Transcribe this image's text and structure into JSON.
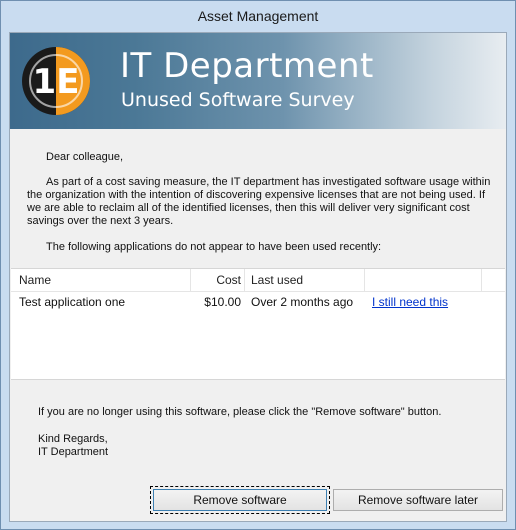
{
  "window": {
    "title": "Asset Management"
  },
  "banner": {
    "logo_text": "1E",
    "title": "IT Department",
    "subtitle": "Unused Software Survey"
  },
  "letter": {
    "greeting": "Dear colleague,",
    "paragraph1": "As part of a cost saving measure, the IT department has investigated software usage within the organization with the intention of discovering expensive licenses that are not being used. If we are able to reclaim all of the identified licenses, then this will deliver very significant cost savings over the next 3 years.",
    "paragraph2": "The following applications do not appear to have been used recently:"
  },
  "list": {
    "columns": [
      "Name",
      "Cost",
      "Last used",
      ""
    ],
    "rows": [
      {
        "name": "Test application one",
        "cost": "$10.00",
        "last_used": "Over 2 months ago",
        "action": "I still need this"
      }
    ]
  },
  "footer": {
    "instruction": "If you are no longer using this software, please click the \"Remove software\" button.",
    "regards": "Kind Regards,",
    "signature": "IT Department"
  },
  "buttons": {
    "remove": "Remove software",
    "remove_later": "Remove software later"
  },
  "colors": {
    "link": "#0033cc",
    "banner_dark": "#3d6a8c",
    "logo_orange": "#f39a1f"
  }
}
